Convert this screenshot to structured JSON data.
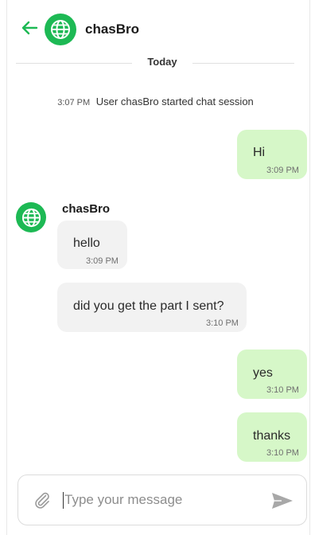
{
  "header": {
    "contact_name": "chasBro"
  },
  "divider": {
    "label": "Today"
  },
  "system_message": {
    "time": "3:07 PM",
    "text": "User chasBro started chat session"
  },
  "messages": [
    {
      "direction": "out",
      "text": "Hi",
      "time": "3:09 PM"
    },
    {
      "direction": "in",
      "sender": "chasBro",
      "text": "hello",
      "time": "3:09 PM"
    },
    {
      "direction": "in",
      "text": "did you get the part I sent?",
      "time": "3:10 PM"
    },
    {
      "direction": "out",
      "text": "yes",
      "time": "3:10 PM"
    },
    {
      "direction": "out",
      "text": "thanks",
      "time": "3:10 PM"
    }
  ],
  "composer": {
    "placeholder": "Type your message"
  },
  "colors": {
    "accent": "#1db954",
    "outgoing_bubble": "#d6f7c8",
    "incoming_bubble": "#f2f2f2"
  },
  "icons": {
    "back": "arrow-left-icon",
    "avatar": "globe-icon",
    "attach": "paperclip-icon",
    "send": "send-icon"
  }
}
